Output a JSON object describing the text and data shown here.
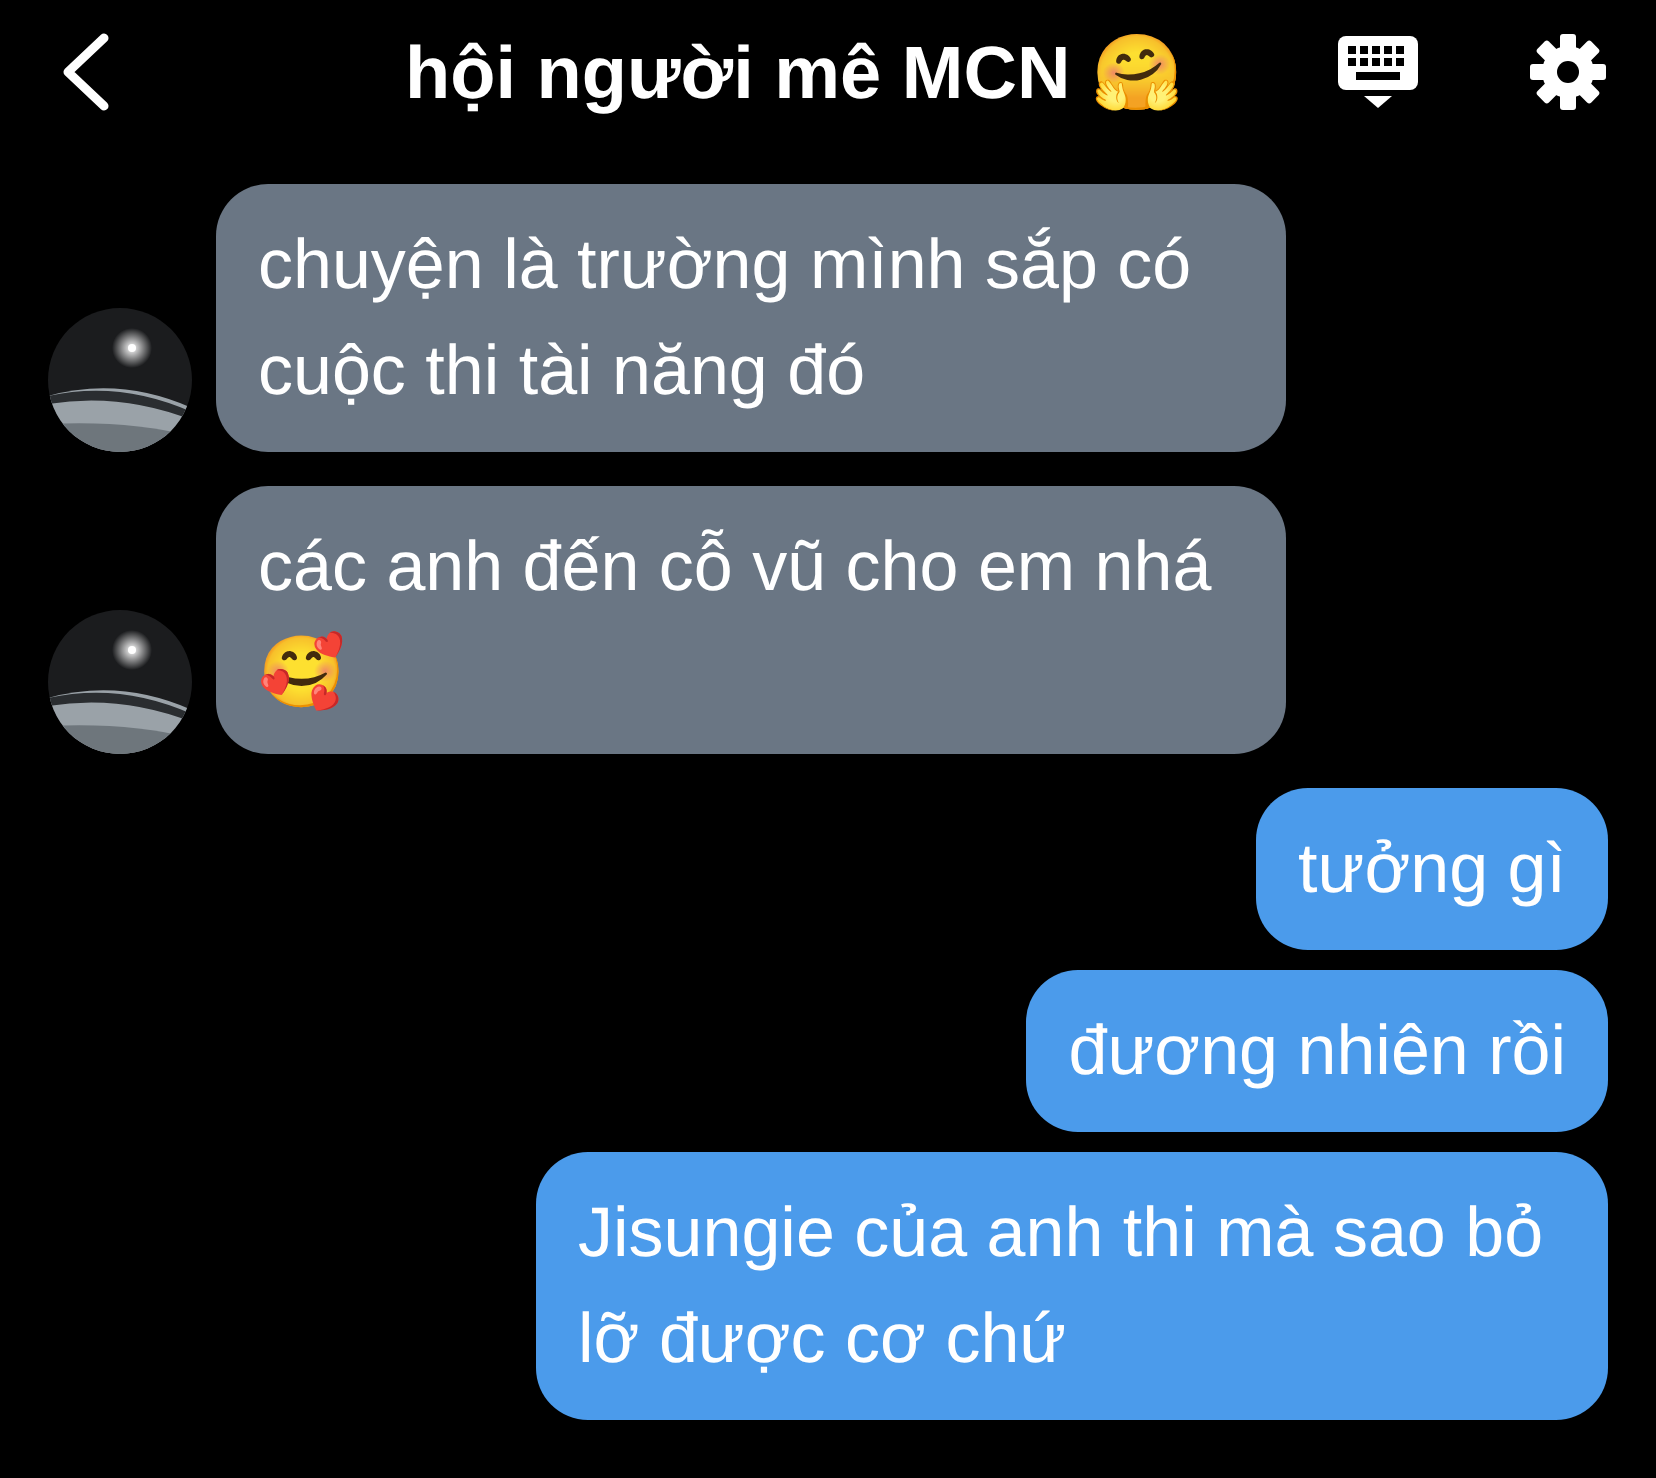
{
  "header": {
    "title": "hội người mê MCN 🤗"
  },
  "messages": [
    {
      "kind": "incoming",
      "text": "chuyện là trường mình sắp có cuộc thi tài năng đó"
    },
    {
      "kind": "incoming",
      "text": "các anh đến cỗ vũ cho em nhá 🥰"
    },
    {
      "kind": "outgoing",
      "text": "tưởng gì"
    },
    {
      "kind": "outgoing",
      "text": "đương nhiên rồi"
    },
    {
      "kind": "outgoing",
      "text": "Jisungie của anh thi mà sao bỏ lỡ được cơ chứ"
    }
  ]
}
